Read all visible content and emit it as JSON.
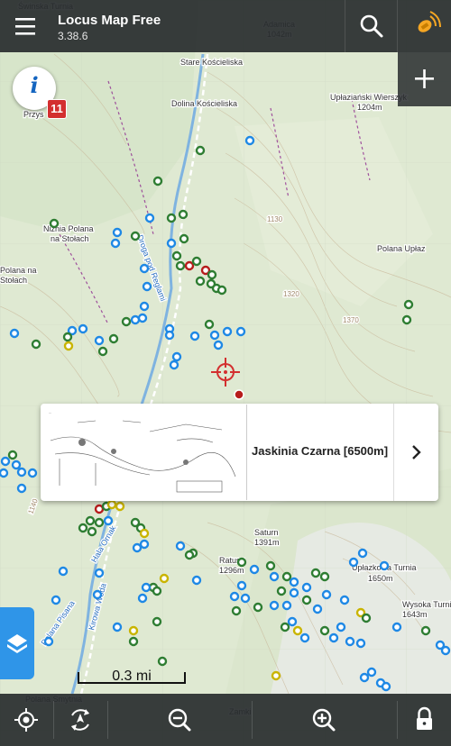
{
  "app": {
    "title": "Locus Map Free",
    "version": "3.38.6"
  },
  "info": {
    "badge": "11"
  },
  "popup": {
    "title": "Jaskinia Czarna [6500m]"
  },
  "scale": {
    "label": "0.3 mi"
  },
  "map_labels": [
    {
      "text": "Świnska Turnia",
      "cls": "dark"
    },
    {
      "text": "Adamica",
      "cls": "dark"
    },
    {
      "text": "1042m",
      "cls": "dark"
    },
    {
      "text": "Stare Kościeliska",
      "cls": "dark"
    },
    {
      "text": "Dolina Kościeliska",
      "cls": "dark"
    },
    {
      "text": "Upłaziański Wierszyk",
      "cls": "dark"
    },
    {
      "text": "1204m",
      "cls": "dark"
    },
    {
      "text": "Niżnia Polana",
      "cls": "dark"
    },
    {
      "text": "na Stołach",
      "cls": "dark"
    },
    {
      "text": "Polana Upłaz",
      "cls": "dark"
    },
    {
      "text": "Saturn",
      "cls": "dark"
    },
    {
      "text": "1391m",
      "cls": "dark"
    },
    {
      "text": "Upłazkowa Turnia",
      "cls": "dark"
    },
    {
      "text": "1650m",
      "cls": "dark"
    },
    {
      "text": "Wysoka Turnia",
      "cls": "dark"
    },
    {
      "text": "1643m",
      "cls": "dark"
    },
    {
      "text": "Polana Smytnia",
      "cls": "dark"
    },
    {
      "text": "Zamki",
      "cls": "dark"
    },
    {
      "text": "Ratusz",
      "cls": "dark"
    },
    {
      "text": "1296m",
      "cls": "dark"
    },
    {
      "text": "Przys",
      "cls": "dark"
    },
    {
      "text": "1130",
      "cls": "contour"
    },
    {
      "text": "1320",
      "cls": "contour"
    },
    {
      "text": "1370",
      "cls": "contour"
    },
    {
      "text": "1140",
      "cls": "contour"
    },
    {
      "text": "Droga pod Reglami",
      "cls": "road"
    },
    {
      "text": "Polana Pisana",
      "cls": "road"
    },
    {
      "text": "Hala Ornak",
      "cls": "road"
    },
    {
      "text": "Kirowa Woda",
      "cls": "road"
    },
    {
      "text": "Polana na",
      "cls": "dark"
    },
    {
      "text": "Stołach",
      "cls": "dark"
    }
  ],
  "colors": {
    "toolbar": "#2c3032",
    "accent": "#2f95e8",
    "badge": "#d32f2f",
    "map": "#dfe9d2"
  },
  "icons": {
    "menu": "menu-icon",
    "search": "search-icon",
    "gps": "gps-satellite-icon",
    "add": "plus-icon",
    "layers": "layers-icon",
    "locate": "my-location-icon",
    "rotate": "map-rotate-icon",
    "zoom_out": "zoom-out-icon",
    "zoom_in": "zoom-in-icon",
    "lock": "lock-icon"
  }
}
